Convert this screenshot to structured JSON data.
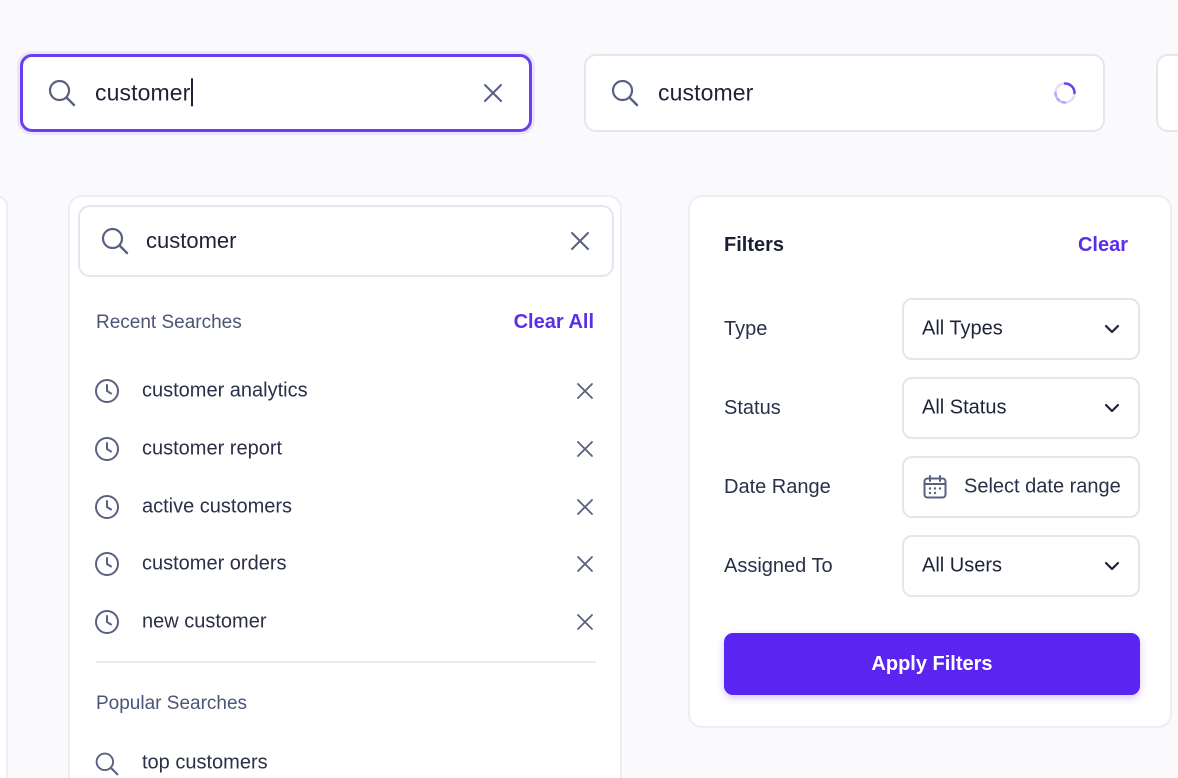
{
  "colors": {
    "accent": "#5a25f0",
    "focus_border": "#6b3ef0",
    "link": "#5b2ee8",
    "muted_text": "#4c5577",
    "icon": "#5a6180"
  },
  "search_bars": [
    {
      "state": "focused",
      "value": "customer",
      "clear_icon": "close-icon"
    },
    {
      "state": "loading",
      "value": "customer",
      "status_icon": "spinner-icon"
    }
  ],
  "dropdown": {
    "search_value": "customer",
    "recent": {
      "title": "Recent Searches",
      "clear_all_label": "Clear All",
      "items": [
        {
          "label": "customer analytics"
        },
        {
          "label": "customer report"
        },
        {
          "label": "active customers"
        },
        {
          "label": "customer orders"
        },
        {
          "label": "new customer"
        }
      ]
    },
    "popular": {
      "title": "Popular Searches",
      "items": [
        {
          "label": "top customers"
        }
      ]
    }
  },
  "filters": {
    "title": "Filters",
    "clear_label": "Clear",
    "type": {
      "label": "Type",
      "value": "All Types"
    },
    "status": {
      "label": "Status",
      "value": "All Status"
    },
    "date_range": {
      "label": "Date Range",
      "placeholder": "Select date range"
    },
    "assigned_to": {
      "label": "Assigned To",
      "value": "All Users"
    },
    "apply_label": "Apply Filters"
  }
}
